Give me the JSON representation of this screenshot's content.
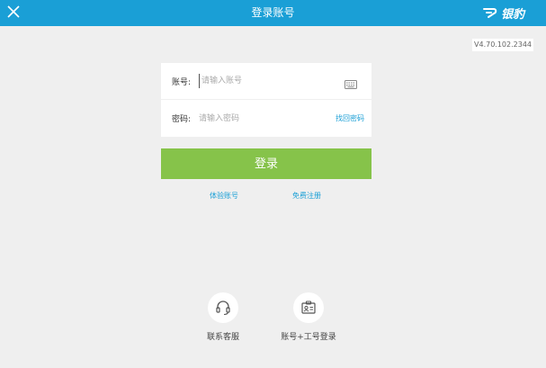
{
  "window": {
    "title": "登录账号",
    "brand": "银豹",
    "version": "V4.70.102.2344"
  },
  "form": {
    "account_label": "账号:",
    "account_placeholder": "请输入账号",
    "password_label": "密码:",
    "password_placeholder": "请输入密码",
    "forgot_password": "找回密码"
  },
  "actions": {
    "login": "登录",
    "trial_account": "体验账号",
    "free_register": "免费注册"
  },
  "bottom": {
    "contact_service": "联系客服",
    "worker_login": "账号+工号登录"
  },
  "colors": {
    "titlebar": "#1a9fd6",
    "login_button": "#86c34a",
    "link": "#1a9fd6",
    "background": "#efefef"
  }
}
